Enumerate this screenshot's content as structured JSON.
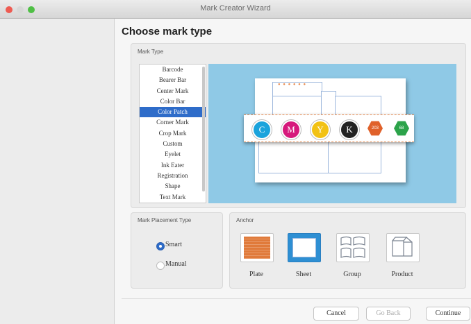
{
  "window": {
    "title": "Mark Creator Wizard"
  },
  "page": {
    "title": "Choose mark type"
  },
  "mark_type": {
    "label": "Mark Type",
    "items": [
      "Barcode",
      "Bearer Bar",
      "Center Mark",
      "Color Bar",
      "Color Patch",
      "Corner Mark",
      "Crop Mark",
      "Custom",
      "Eyelet",
      "Ink Eater",
      "Registration",
      "Shape",
      "Text Mark"
    ],
    "selected": "Color Patch"
  },
  "preview": {
    "patches": [
      {
        "text": "C",
        "color": "#1aa3dc"
      },
      {
        "text": "M",
        "color": "#d6197c"
      },
      {
        "text": "Y",
        "color": "#f2c214"
      },
      {
        "text": "K",
        "color": "#222222"
      }
    ],
    "spots": [
      {
        "text": "203",
        "color": "#e0612a"
      },
      {
        "text": "68",
        "color": "#2ca34a"
      }
    ]
  },
  "placement": {
    "label": "Mark Placement Type",
    "options": [
      {
        "label": "Smart",
        "selected": true
      },
      {
        "label": "Manual",
        "selected": false
      }
    ]
  },
  "anchor": {
    "label": "Anchor",
    "options": [
      "Plate",
      "Sheet",
      "Group",
      "Product"
    ],
    "selected": "Sheet"
  },
  "buttons": {
    "cancel": "Cancel",
    "back": "Go Back",
    "continue": "Continue"
  },
  "colors": {
    "selection": "#2e6cc9",
    "preview_bg": "#8fc9e6",
    "plate": "#e07a3a"
  }
}
